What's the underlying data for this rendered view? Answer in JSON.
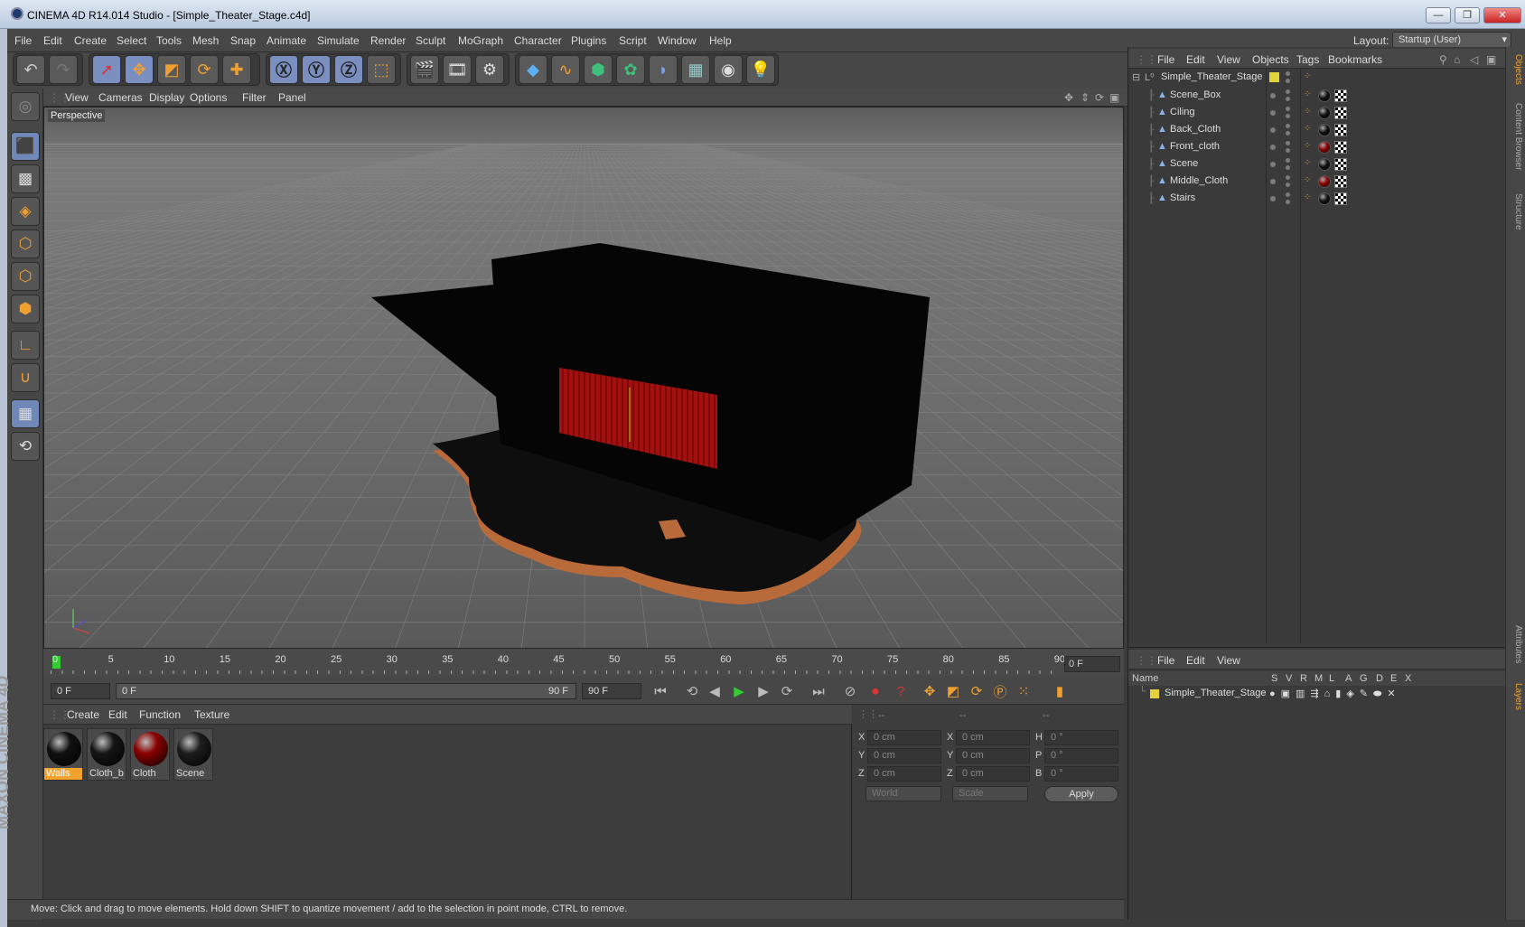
{
  "window": {
    "title": "CINEMA 4D R14.014 Studio - [Simple_Theater_Stage.c4d]",
    "min": "—",
    "max": "❐",
    "close": "✕"
  },
  "menubar": {
    "items": [
      "File",
      "Edit",
      "Create",
      "Select",
      "Tools",
      "Mesh",
      "Snap",
      "Animate",
      "Simulate",
      "Render",
      "Sculpt",
      "MoGraph",
      "Character",
      "Plugins",
      "Script",
      "Window",
      "Help"
    ],
    "layout_label": "Layout:",
    "layout_value": "Startup (User)"
  },
  "toolbar": {
    "icons": [
      "undo-icon",
      "redo-icon",
      "live-selection-icon",
      "move-icon",
      "scale-icon",
      "rotate-icon",
      "recent-tool-icon",
      "x-axis-icon",
      "y-axis-icon",
      "z-axis-icon",
      "coordinate-system-icon",
      "render-view-icon",
      "render-picture-viewer-icon",
      "render-settings-icon",
      "cube-icon",
      "spline-pen-icon",
      "nurbs-icon",
      "array-icon",
      "deformer-icon",
      "floor-icon",
      "camera-icon",
      "light-icon"
    ]
  },
  "viewport": {
    "menu": [
      "View",
      "Cameras",
      "Display",
      "Options",
      "Filter",
      "Panel"
    ],
    "label": "Perspective"
  },
  "timeline": {
    "ticks": [
      "0",
      "5",
      "10",
      "15",
      "20",
      "25",
      "30",
      "35",
      "40",
      "45",
      "50",
      "55",
      "60",
      "65",
      "70",
      "75",
      "80",
      "85",
      "90"
    ],
    "current_frame": "0 F"
  },
  "transport": {
    "start": "0 F",
    "range_start": "0 F",
    "range_end": "90 F",
    "end": "90 F"
  },
  "materials": {
    "menu": [
      "Create",
      "Edit",
      "Function",
      "Texture"
    ],
    "items": [
      {
        "name": "Walls",
        "color": "#101010",
        "selected": true
      },
      {
        "name": "Cloth_b",
        "color": "#151515",
        "selected": false
      },
      {
        "name": "Cloth",
        "color": "#8a0000",
        "selected": false
      },
      {
        "name": "Scene",
        "color": "#1d1d1d",
        "selected": false
      }
    ]
  },
  "coords": {
    "headers": [
      "--",
      "--",
      "--"
    ],
    "rows": [
      {
        "a": "X",
        "av": "0 cm",
        "b": "X",
        "bv": "0 cm",
        "c": "H",
        "cv": "0 °"
      },
      {
        "a": "Y",
        "av": "0 cm",
        "b": "Y",
        "bv": "0 cm",
        "c": "P",
        "cv": "0 °"
      },
      {
        "a": "Z",
        "av": "0 cm",
        "b": "Z",
        "bv": "0 cm",
        "c": "B",
        "cv": "0 °"
      }
    ],
    "world": "World",
    "scale": "Scale",
    "apply": "Apply"
  },
  "status": "Move: Click and drag to move elements. Hold down SHIFT to quantize movement / add to the selection in point mode, CTRL to remove.",
  "objects": {
    "menu": [
      "File",
      "Edit",
      "View",
      "Objects",
      "Tags",
      "Bookmarks"
    ],
    "root": "Simple_Theater_Stage",
    "children": [
      {
        "name": "Scene_Box",
        "tag": "#111111"
      },
      {
        "name": "Ciling",
        "tag": "#111111"
      },
      {
        "name": "Back_Cloth",
        "tag": "#111111"
      },
      {
        "name": "Front_cloth",
        "tag": "#8a0000"
      },
      {
        "name": "Scene",
        "tag": "#111111"
      },
      {
        "name": "Middle_Cloth",
        "tag": "#8a0000"
      },
      {
        "name": "Stairs",
        "tag": "#111111"
      }
    ]
  },
  "layers": {
    "menu": [
      "File",
      "Edit",
      "View"
    ],
    "headers": [
      "Name",
      "S",
      "V",
      "R",
      "M",
      "L",
      "A",
      "G",
      "D",
      "E",
      "X"
    ],
    "row": "Simple_Theater_Stage"
  },
  "sidetabs": [
    "Objects",
    "Content Browser",
    "Structure",
    "Attributes",
    "Layers"
  ],
  "brand": "MAXON CINEMA 4D",
  "colors": {
    "accent": "#f3a22e",
    "panel": "#3b3b3b",
    "curtain": "#a31010"
  }
}
